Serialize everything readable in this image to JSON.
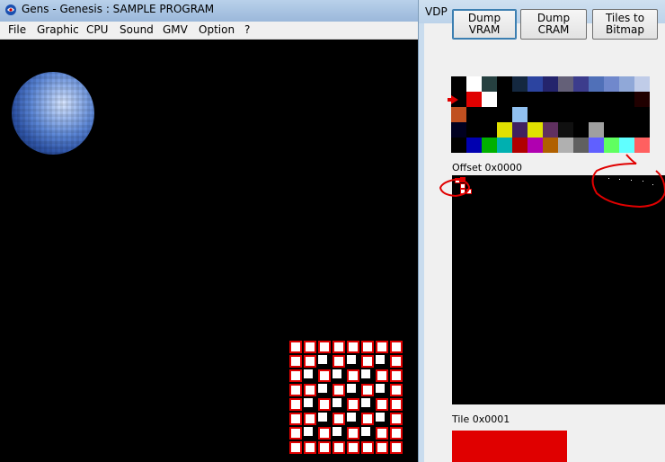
{
  "gens": {
    "title": "Gens - Genesis : SAMPLE PROGRAM",
    "menu": [
      "File",
      "Graphic",
      "CPU",
      "Sound",
      "GMV",
      "Option",
      "?"
    ]
  },
  "vdp": {
    "title": "VDP",
    "buttons": {
      "dump_vram": "Dump VRAM",
      "dump_cram": "Dump CRAM",
      "tiles_to_bitmap_line1": "Tiles to",
      "tiles_to_bitmap_line2": "Bitmap"
    },
    "offset_label": "Offset 0x0000",
    "tile_label": "Tile 0x0001",
    "palette_rows": [
      [
        "#000000",
        "#ffffff",
        "#264040",
        "#000000",
        "#142840",
        "#2c44a0",
        "#24246c",
        "#646078",
        "#3c3c8c",
        "#5070b8",
        "#7088cc",
        "#90a8d8",
        "#c0cce8"
      ],
      [
        "#000000",
        "#e00000",
        "#ffffff",
        "#000000",
        "#000000",
        "#000000",
        "#000000",
        "#000000",
        "#000000",
        "#000000",
        "#000000",
        "#000000",
        "#200000"
      ],
      [
        "#c05020",
        "#000000",
        "#000000",
        "#000000",
        "#90c0f0",
        "#000000",
        "#000000",
        "#000000",
        "#000000",
        "#000000",
        "#000000",
        "#000000",
        "#000000"
      ],
      [
        "#000020",
        "#000000",
        "#000000",
        "#e0e000",
        "#402060",
        "#e0e000",
        "#603060",
        "#101010",
        "#000000",
        "#a0a0a0",
        "#000000",
        "#000000",
        "#000000"
      ],
      [
        "#000000",
        "#0000b0",
        "#00b000",
        "#00b0b0",
        "#b00000",
        "#b000b0",
        "#b06000",
        "#b0b0b0",
        "#606060",
        "#6060ff",
        "#60ff60",
        "#60ffff",
        "#ff6060"
      ]
    ]
  }
}
